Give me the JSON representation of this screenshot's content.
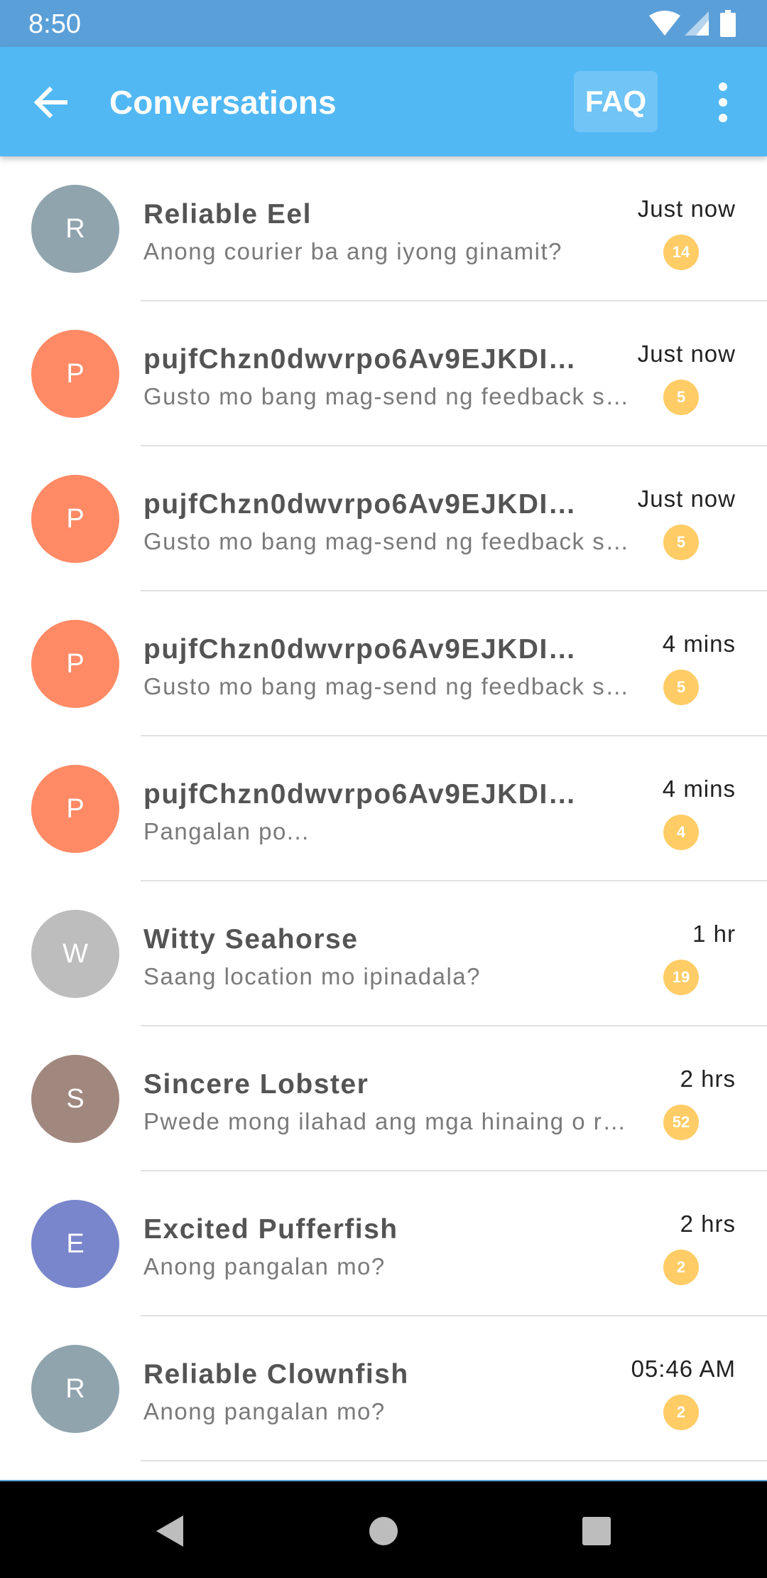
{
  "status_bar": {
    "time": "8:50",
    "icons": [
      "wifi-icon",
      "cellular-signal-icon",
      "battery-icon"
    ]
  },
  "app_bar": {
    "title": "Conversations",
    "faq_label": "FAQ",
    "icons": [
      "back-arrow-icon",
      "more-vert-icon"
    ],
    "background": "#51b8f4"
  },
  "conversations": [
    {
      "initial": "R",
      "name": "Reliable Eel",
      "preview": "Anong courier ba ang iyong ginamit?",
      "time": "Just now",
      "unread": "14",
      "avatar_color": "#90a4ae"
    },
    {
      "initial": "P",
      "name": "pujfChzn0dwvrpo6Av9EJKDIS…",
      "preview": "Gusto mo bang mag-send ng feedback s…",
      "time": "Just now",
      "unread": "5",
      "avatar_color": "#ff8a65"
    },
    {
      "initial": "P",
      "name": "pujfChzn0dwvrpo6Av9EJKDIS…",
      "preview": "Gusto mo bang mag-send ng feedback s…",
      "time": "Just now",
      "unread": "5",
      "avatar_color": "#ff8a65"
    },
    {
      "initial": "P",
      "name": "pujfChzn0dwvrpo6Av9EJKDIS…",
      "preview": "Gusto mo bang mag-send ng feedback s…",
      "time": "4 mins",
      "unread": "5",
      "avatar_color": "#ff8a65"
    },
    {
      "initial": "P",
      "name": "pujfChzn0dwvrpo6Av9EJKDIS…",
      "preview": "Pangalan po...",
      "time": "4 mins",
      "unread": "4",
      "avatar_color": "#ff8a65"
    },
    {
      "initial": "W",
      "name": "Witty Seahorse",
      "preview": "Saang location mo ipinadala?",
      "time": "1 hr",
      "unread": "19",
      "avatar_color": "#bdbdbd"
    },
    {
      "initial": "S",
      "name": "Sincere Lobster",
      "preview": "Pwede mong ilahad ang mga hinaing o r…",
      "time": "2 hrs",
      "unread": "52",
      "avatar_color": "#a1887f"
    },
    {
      "initial": "E",
      "name": "Excited Pufferfish",
      "preview": "Anong pangalan mo?",
      "time": "2 hrs",
      "unread": "2",
      "avatar_color": "#7986cb"
    },
    {
      "initial": "R",
      "name": "Reliable Clownfish",
      "preview": "Anong pangalan mo?",
      "time": "05:46 AM",
      "unread": "2",
      "avatar_color": "#90a4ae"
    }
  ],
  "nav_bar": {
    "icons": [
      "back-triangle-icon",
      "home-circle-icon",
      "recents-square-icon"
    ]
  }
}
